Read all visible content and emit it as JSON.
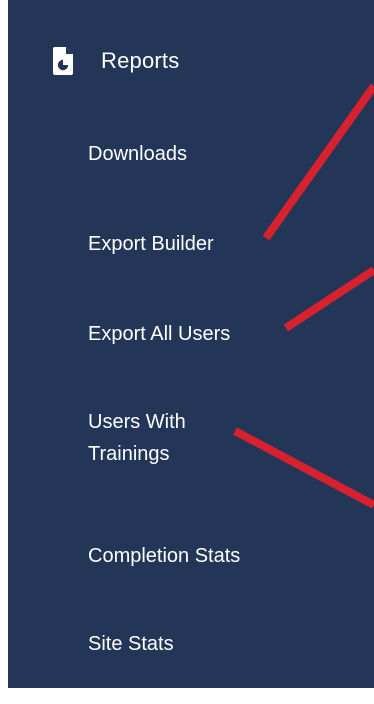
{
  "sidebar": {
    "section": {
      "title": "Reports",
      "icon": "report-document-icon"
    },
    "items": [
      {
        "label": "Downloads"
      },
      {
        "label": "Export Builder"
      },
      {
        "label": "Export All Users"
      },
      {
        "label": "Users With Trainings"
      },
      {
        "label": "Completion Stats"
      },
      {
        "label": "Site Stats"
      }
    ]
  },
  "colors": {
    "sidebar_background": "#233658",
    "text": "#ffffff",
    "annotation_lines": "#d7212f"
  }
}
